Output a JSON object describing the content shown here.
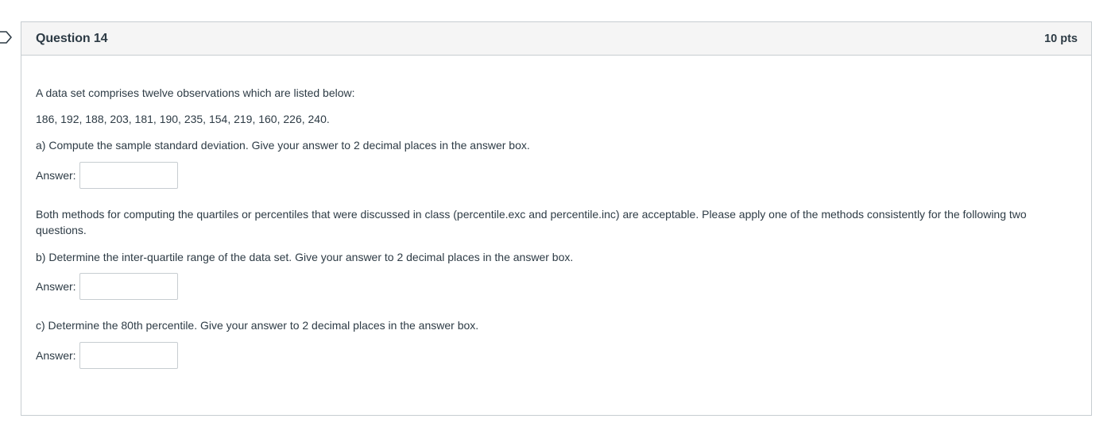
{
  "question": {
    "title": "Question 14",
    "points": "10 pts",
    "intro": "A data set comprises twelve observations which are listed below:",
    "data_values": "186, 192, 188, 203, 181, 190, 235, 154, 219, 160, 226, 240.",
    "part_a": "a) Compute the sample standard deviation. Give your answer to 2 decimal places in the answer box.",
    "note": "Both methods for computing the quartiles or percentiles that were discussed in class (percentile.exc and percentile.inc) are acceptable. Please apply one of the methods consistently for the following two questions.",
    "part_b": "b) Determine the inter-quartile range of the data set. Give your answer to 2 decimal places in the answer box.",
    "part_c": "c) Determine the 80th percentile. Give your answer to 2 decimal places in the answer box.",
    "answer_label": "Answer:",
    "answer_a_value": "",
    "answer_b_value": "",
    "answer_c_value": ""
  },
  "colors": {
    "text": "#2d3b45",
    "border": "#c7cdd1",
    "header_bg": "#f5f5f5"
  },
  "icons": {
    "flag": "flag-icon"
  }
}
